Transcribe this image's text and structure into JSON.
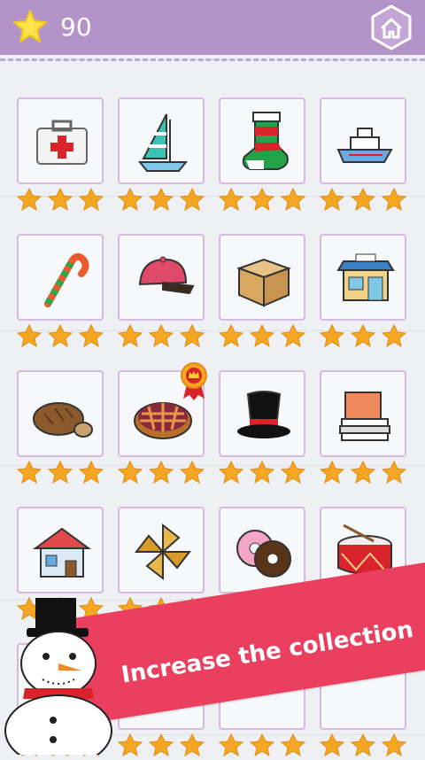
{
  "header": {
    "score": "90",
    "score_icon": "star-icon",
    "home_icon": "home-icon"
  },
  "colors": {
    "header_bg": "#b493c9",
    "card_border": "#d6b9df",
    "star": "#f5a623",
    "banner": "#ea3f5f"
  },
  "collection": [
    {
      "name": "first-aid-kit",
      "stars": 3
    },
    {
      "name": "sailboat",
      "stars": 3
    },
    {
      "name": "christmas-stocking",
      "stars": 3
    },
    {
      "name": "ship",
      "stars": 3
    },
    {
      "name": "candy-cane",
      "stars": 3
    },
    {
      "name": "baseball-cap",
      "stars": 3
    },
    {
      "name": "cardboard-box",
      "stars": 3
    },
    {
      "name": "shop",
      "stars": 3
    },
    {
      "name": "bread",
      "stars": 3
    },
    {
      "name": "pie",
      "stars": 3,
      "badge": true
    },
    {
      "name": "top-hat",
      "stars": 3
    },
    {
      "name": "books",
      "stars": 3
    },
    {
      "name": "house",
      "stars": 3
    },
    {
      "name": "pinwheel",
      "stars": 3
    },
    {
      "name": "donuts",
      "stars": 3
    },
    {
      "name": "drum",
      "stars": 3
    },
    {
      "name": "hidden-item",
      "stars": 3,
      "badge": true
    },
    {
      "name": "hidden-item",
      "stars": 3
    },
    {
      "name": "hidden-item",
      "stars": 3
    },
    {
      "name": "hidden-item",
      "stars": 3
    }
  ],
  "banner": {
    "text": "Increase the collection"
  }
}
